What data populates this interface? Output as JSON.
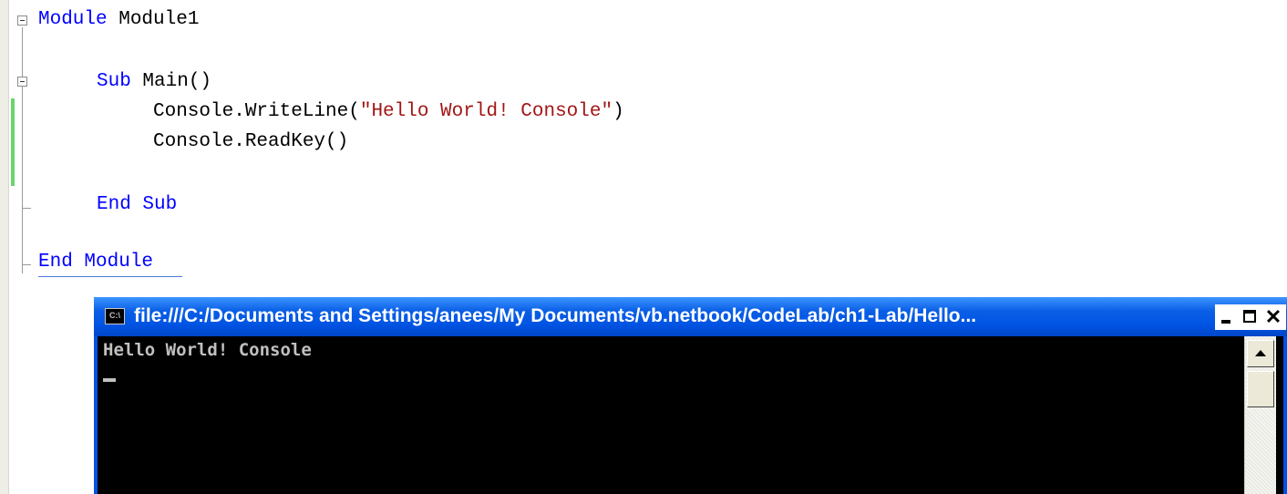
{
  "editor": {
    "lines": [
      {
        "keyword": "Module",
        "rest": " Module1"
      },
      {
        "keyword": "Sub",
        "rest": " Main()"
      },
      {
        "pre": "Console.WriteLine(",
        "string": "\"Hello World! Console\"",
        "post": ")"
      },
      {
        "text": "Console.ReadKey()"
      },
      {
        "keyword": "End Sub"
      },
      {
        "keyword": "End Module"
      }
    ]
  },
  "console_window": {
    "icon_label": "C:\\",
    "title": "file:///C:/Documents and Settings/anees/My Documents/vb.netbook/CodeLab/ch1-Lab/Hello...",
    "output": "Hello World! Console",
    "close_glyph": "✕"
  },
  "colors": {
    "keyword": "#0000ff",
    "string": "#a31515",
    "titlebar": "#0054e3",
    "console_bg": "#000000",
    "console_text": "#c0c0c0"
  }
}
